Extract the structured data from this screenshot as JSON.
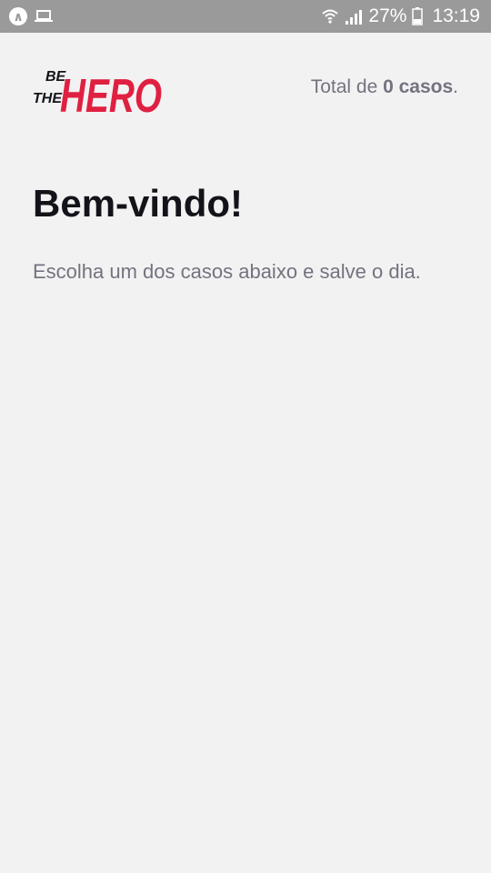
{
  "status_bar": {
    "battery": "27%",
    "time": "13:19",
    "icons": [
      "app-notification-icon",
      "laptop-icon",
      "wifi-icon",
      "signal-icon",
      "battery-icon"
    ]
  },
  "header": {
    "logo": {
      "line1": "BE",
      "line2": "THE",
      "hero": "HERO"
    },
    "total_prefix": "Total de ",
    "total_value": "0 casos",
    "total_suffix": "."
  },
  "content": {
    "title": "Bem-vindo!",
    "description": "Escolha um dos casos abaixo e salve o dia."
  },
  "colors": {
    "brand": "#e02041",
    "background": "#f2f2f2",
    "text_dark": "#13131a",
    "text_muted": "#737380",
    "status_bar": "#9a9a9a"
  }
}
